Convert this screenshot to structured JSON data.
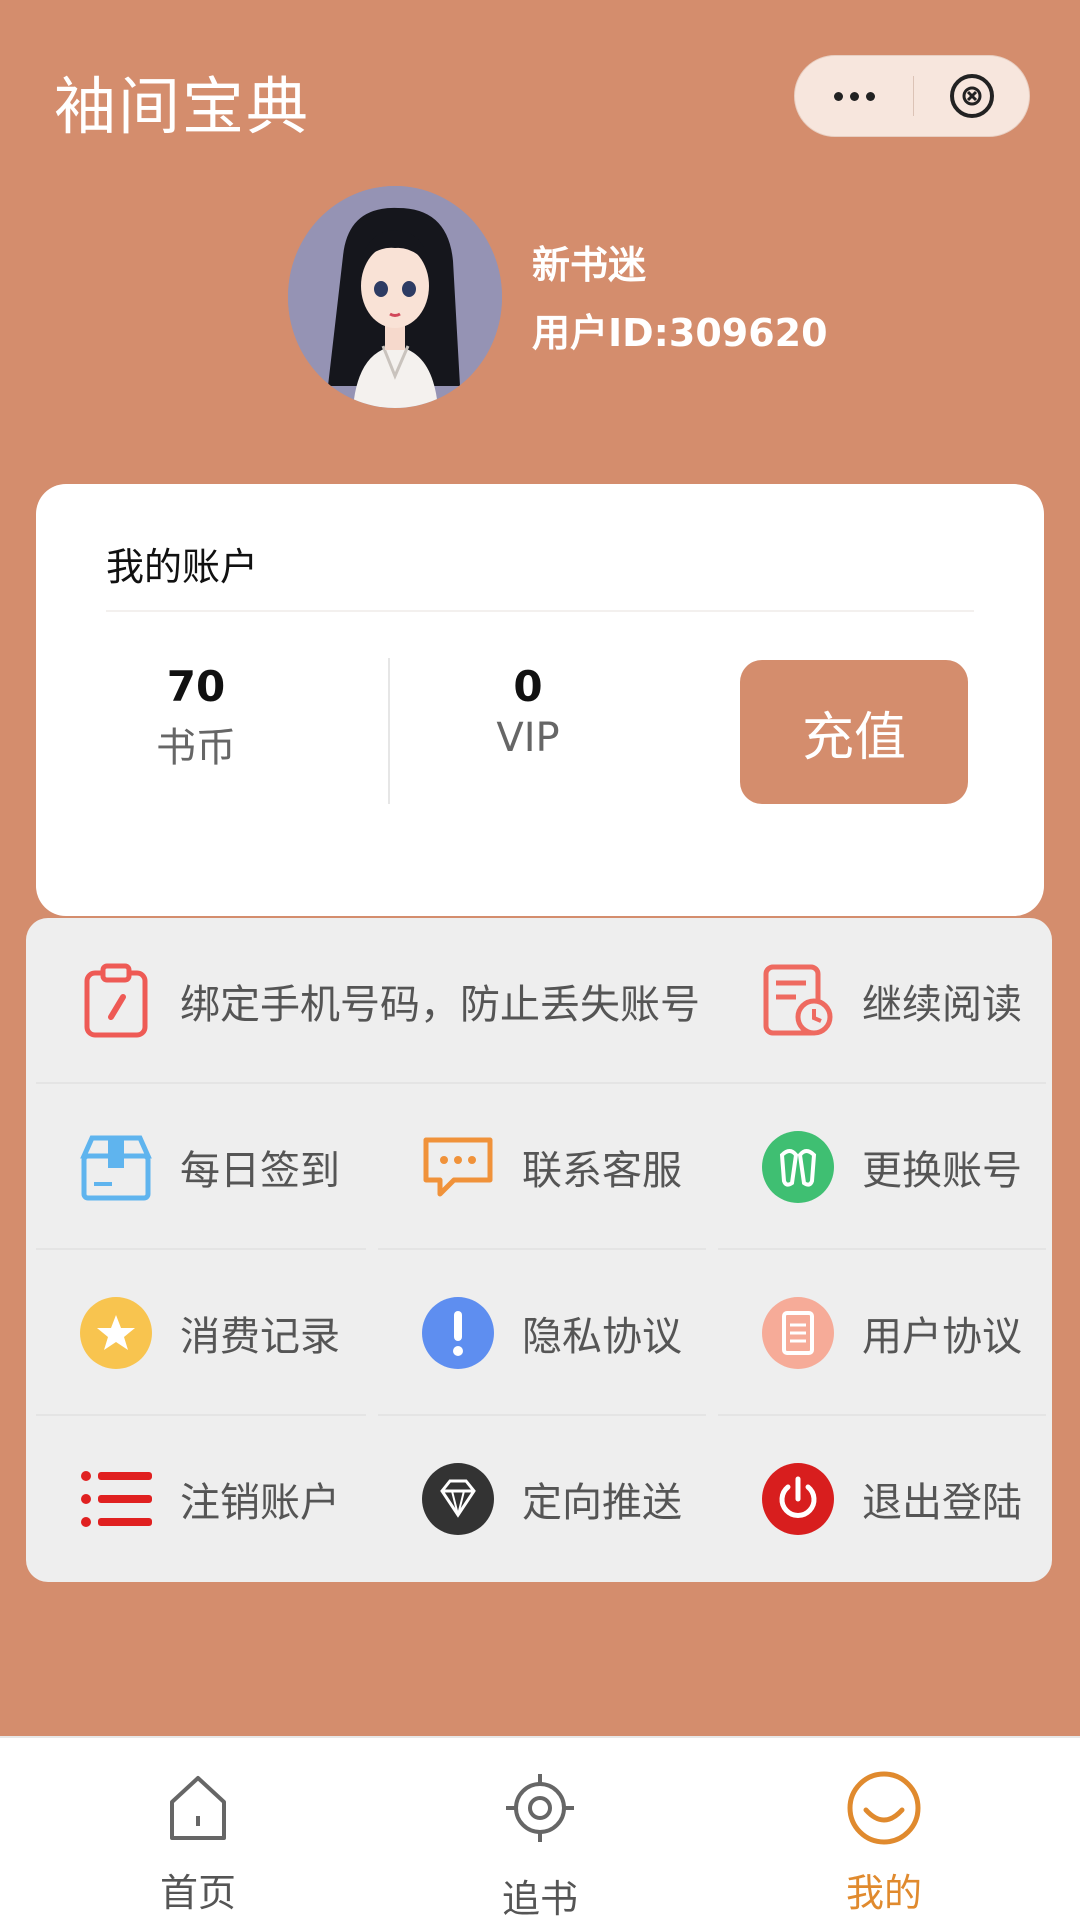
{
  "header": {
    "title": "袖间宝典"
  },
  "profile": {
    "name": "新书迷",
    "user_id": "用户ID:309620"
  },
  "account": {
    "title": "我的账户",
    "coins_value": "70",
    "coins_label": "书币",
    "vip_value": "0",
    "vip_label": "VIP",
    "recharge_label": "充值"
  },
  "menu": {
    "bind_phone": "绑定手机号码，防止丢失账号",
    "continue_reading": "继续阅读",
    "daily_checkin": "每日签到",
    "contact_service": "联系客服",
    "switch_account": "更换账号",
    "consumption_records": "消费记录",
    "privacy_policy": "隐私协议",
    "user_agreement": "用户协议",
    "cancel_account": "注销账户",
    "targeted_push": "定向推送",
    "logout": "退出登陆"
  },
  "tabbar": {
    "home": "首页",
    "follow": "追书",
    "mine": "我的"
  },
  "colors": {
    "brand": "#d48d6d",
    "active_tab": "#e08a2e"
  }
}
